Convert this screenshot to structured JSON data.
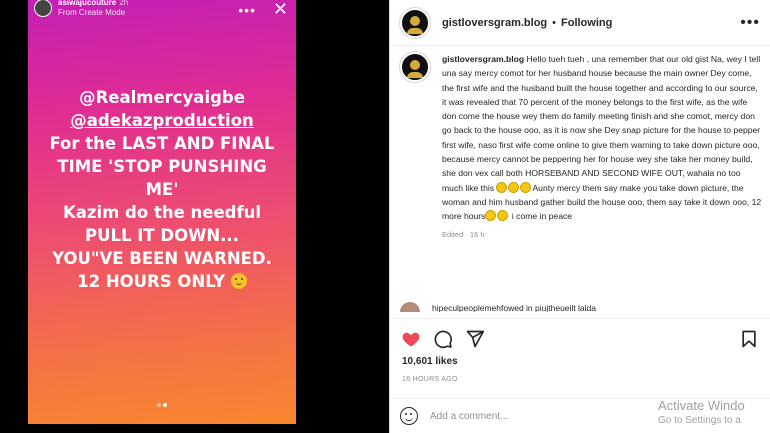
{
  "story": {
    "username": "asiwajucouture",
    "time": "2h",
    "subtitle": "From Create Mode",
    "lines": [
      "@Realmercyaigbe",
      "@adekazproduction",
      "For the LAST AND FINAL",
      "TIME 'STOP PUNSHING",
      "ME'",
      "Kazim do the needful",
      "PULL IT DOWN...",
      "YOU\"VE BEEN WARNED.",
      "12 HOURS ONLY"
    ],
    "page_indicator": {
      "count": 2,
      "active": 2
    }
  },
  "post": {
    "header_username": "gistloversgram.blog",
    "follow_status": "Following",
    "caption_username": "gistloversgram.blog",
    "caption_part1": "Hello tueh tueh , una remember that our old gist Na, wey I tell una say mercy comot for her husband house because the main owner Dey come, the first wife and the husband built the house together and according to our source, it was revealed that 70 percent of the money belongs to the first wife, as the wife don come the house wey them do family meeting finish and she comot, mercy don go back to the house ooo, as it is now she Dey snap picture for the house to pepper first wife, naso first wife come online to give them warning to take down picture ooo, because mercy cannot be peppering her for house wey she take her money build, she don vex call both HORSEBAND AND SECOND WIFE OUT, wahala no too much like this ",
    "caption_part2": "Aunty mercy them say make you take down picture, the woman and him husband gather build the house ooo, them say take it down ooo, 12 more hours",
    "caption_part3": " i come in peace",
    "edited": "Edited · 16 h",
    "next_comment": "hipeculpeoplemehfowed in piujtheueilt lalda",
    "likes": "10,601 likes",
    "time_ago": "16 HOURS AGO",
    "comment_placeholder": "Add a comment...",
    "colors": {
      "like": "#ed4956",
      "text": "#262626",
      "muted": "#8e8e8e"
    }
  },
  "watermark": {
    "line1": "Activate Windo",
    "line2": "Go to Settings to a"
  }
}
